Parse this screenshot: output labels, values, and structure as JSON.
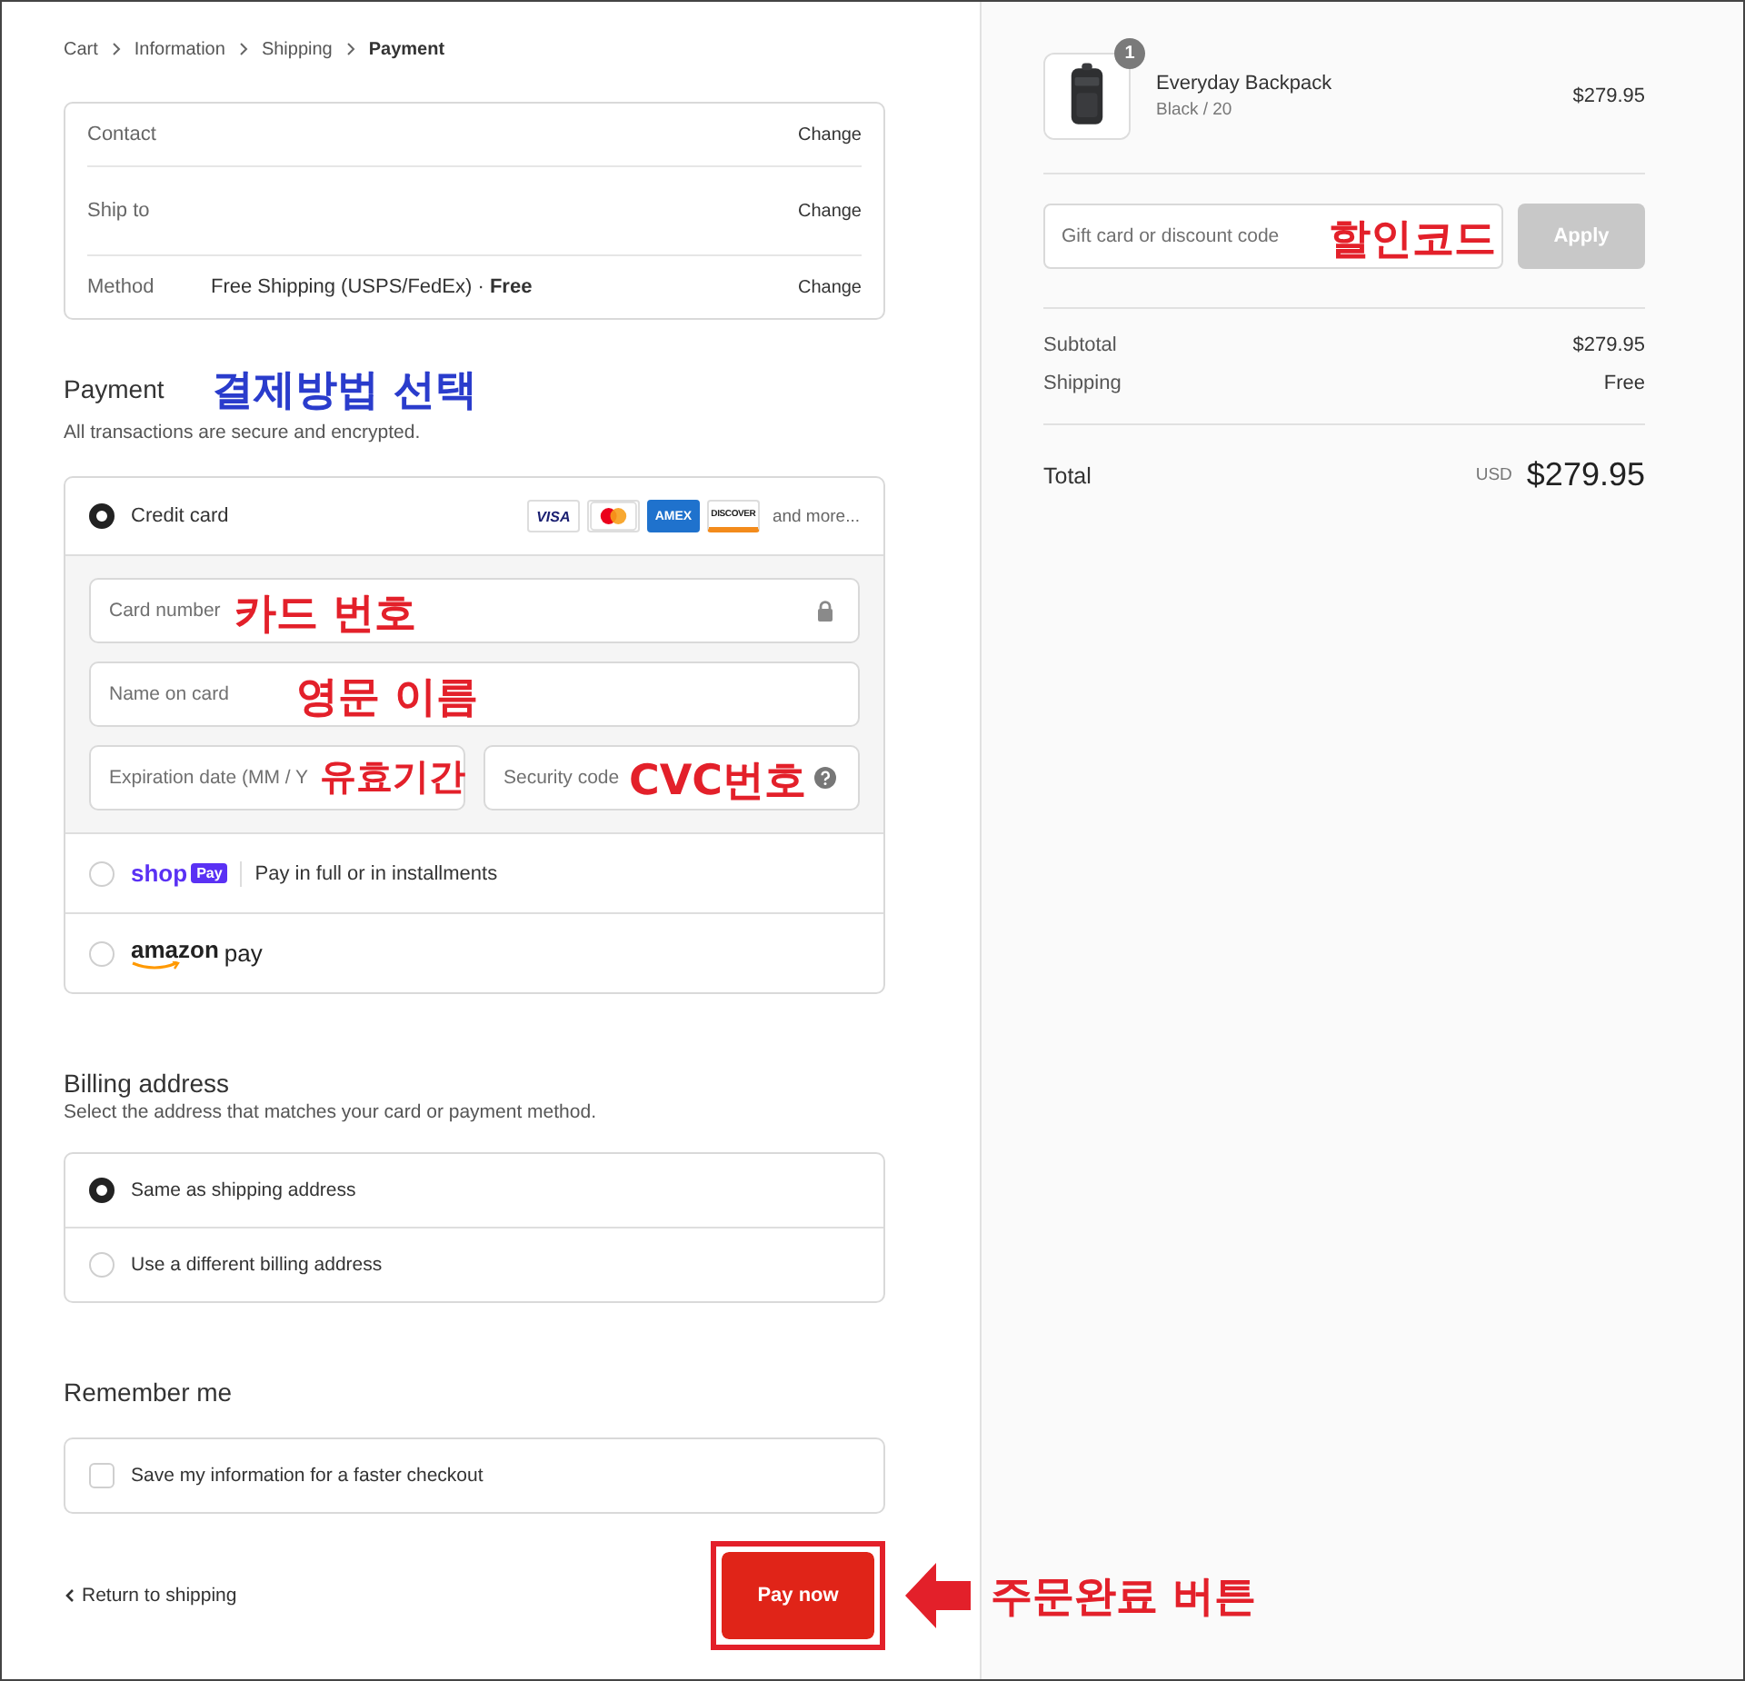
{
  "breadcrumb": [
    {
      "label": "Cart",
      "selected": false
    },
    {
      "label": "Information",
      "selected": false
    },
    {
      "label": "Shipping",
      "selected": false
    },
    {
      "label": "Payment",
      "selected": true
    }
  ],
  "review": [
    {
      "label": "Contact",
      "action": "Change"
    },
    {
      "label": "Ship to",
      "action": "Change"
    },
    {
      "label": "Method",
      "value": "Free Shipping (USPS/FedEx) · **Free**",
      "action": "Change"
    }
  ],
  "payment": {
    "title": "Payment",
    "annotation": {
      "text": "결제방법 선택",
      "color": "#2a3ccc"
    },
    "subtitle": "All transactions are secure and encrypted.",
    "methods": [
      {
        "kind": "card",
        "label": "Credit card",
        "selected": true,
        "more": "and more...",
        "brands": [
          {
            "kind": "visa",
            "label": "VISA"
          },
          {
            "kind": "mastercard"
          },
          {
            "kind": "amex",
            "label": "AMEX"
          },
          {
            "kind": "discover",
            "label": "DISCOVER"
          }
        ],
        "field_rows": [
          [
            {
              "kind": "card_number",
              "placeholder": "Card number",
              "annotation": {
                "text": "카드 번호",
                "color": "#e3202a"
              }
            }
          ],
          [
            {
              "kind": "name",
              "placeholder": "Name on card",
              "annotation": {
                "text": "영문 이름",
                "color": "#e3202a"
              }
            }
          ],
          [
            {
              "kind": "expiry",
              "placeholder": "Expiration date (MM / Y",
              "annotation": {
                "text": "유효기간",
                "color": "#e3202a"
              }
            },
            {
              "kind": "security",
              "placeholder": "Security code",
              "annotation": {
                "text": "CVC번호",
                "color": "#e3202a"
              }
            }
          ]
        ]
      },
      {
        "kind": "shop_pay",
        "logo": "shop",
        "badge": "Pay",
        "label": "Pay in full or in installments",
        "selected": false
      },
      {
        "kind": "amazon_pay",
        "logo": "amazon",
        "suffix": "pay",
        "selected": false
      }
    ]
  },
  "billing": {
    "title": "Billing address",
    "subtitle": "Select the address that matches your card or payment method.",
    "options": [
      {
        "label": "Same as shipping address",
        "selected": true
      },
      {
        "label": "Use a different billing address",
        "selected": false
      }
    ]
  },
  "remember": {
    "title": "Remember me",
    "options": [
      {
        "label": "Save my information for a faster checkout",
        "checked": false
      }
    ]
  },
  "footer": {
    "back": "Return to shipping",
    "pay": "Pay now",
    "annotation": {
      "text": "주문완료 버튼",
      "color": "#e3202a"
    }
  },
  "summary": {
    "item": {
      "name": "Everyday Backpack",
      "variant": "Black / 20",
      "price": "$279.95",
      "quantity": "1"
    },
    "discount": {
      "placeholder": "Gift card or discount code",
      "button": "Apply",
      "disabled": true,
      "annotation": {
        "text": "할인코드",
        "color": "#e3202a"
      }
    },
    "lines": [
      {
        "label": "Subtotal",
        "value": "$279.95"
      },
      {
        "label": "Shipping",
        "value": "Free"
      }
    ],
    "total": {
      "label": "Total",
      "currency": "USD",
      "value": "$279.95"
    }
  }
}
